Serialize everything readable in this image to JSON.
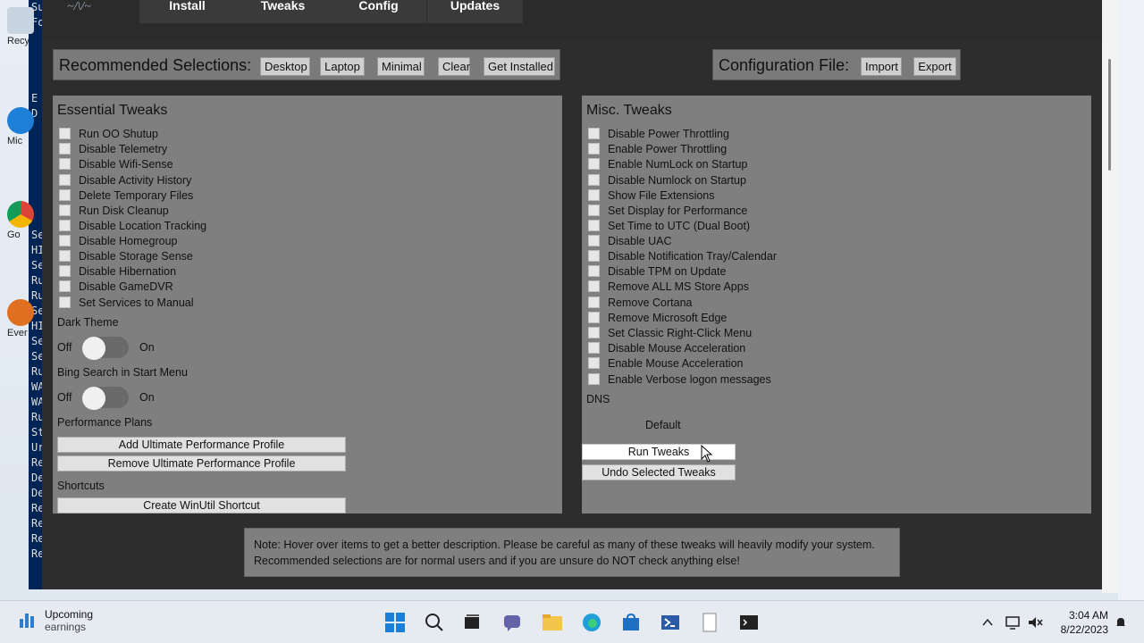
{
  "app": {
    "tabs": [
      "Install",
      "Tweaks",
      "Config",
      "Updates"
    ],
    "active_tab": "Tweaks"
  },
  "recommended": {
    "label": "Recommended Selections:",
    "buttons": [
      "Desktop",
      "Laptop",
      "Minimal",
      "Clear",
      "Get Installed"
    ]
  },
  "config_file": {
    "label": "Configuration File:",
    "buttons": [
      "Import",
      "Export"
    ]
  },
  "essential": {
    "title": "Essential Tweaks",
    "items": [
      "Run OO Shutup",
      "Disable Telemetry",
      "Disable Wifi-Sense",
      "Disable Activity History",
      "Delete Temporary Files",
      "Run Disk Cleanup",
      "Disable Location Tracking",
      "Disable Homegroup",
      "Disable Storage Sense",
      "Disable Hibernation",
      "Disable GameDVR",
      "Set Services to Manual"
    ],
    "dark_theme": {
      "label": "Dark Theme",
      "off": "Off",
      "on": "On"
    },
    "bing_search": {
      "label": "Bing Search in Start Menu",
      "off": "Off",
      "on": "On"
    },
    "performance_plans": {
      "label": "Performance Plans",
      "add": "Add Ultimate Performance Profile",
      "remove": "Remove Ultimate Performance Profile"
    },
    "shortcuts": {
      "label": "Shortcuts",
      "create": "Create WinUtil Shortcut"
    }
  },
  "misc": {
    "title": "Misc. Tweaks",
    "items": [
      "Disable Power Throttling",
      "Enable Power Throttling",
      "Enable NumLock on Startup",
      "Disable Numlock on Startup",
      "Show File Extensions",
      "Set Display for Performance",
      "Set Time to UTC (Dual Boot)",
      "Disable UAC",
      "Disable Notification Tray/Calendar",
      "Disable TPM on Update",
      "Remove ALL MS Store Apps",
      "Remove Cortana",
      "Remove Microsoft Edge",
      "Set Classic Right-Click Menu",
      "Disable Mouse Acceleration",
      "Enable Mouse Acceleration",
      "Enable Verbose logon messages"
    ],
    "dns_label": "DNS",
    "dns_value": "Default",
    "run": "Run Tweaks",
    "undo": "Undo Selected Tweaks"
  },
  "note": {
    "line1": "Note: Hover over items to get a better description. Please be careful as many of these tweaks will heavily modify your system.",
    "line2": "Recommended selections are for normal users and if you are unsure do NOT check anything else!"
  },
  "taskbar": {
    "weather_line1": "Upcoming",
    "weather_line2": "earnings",
    "time": "3:04 AM",
    "date": "8/22/2023"
  }
}
